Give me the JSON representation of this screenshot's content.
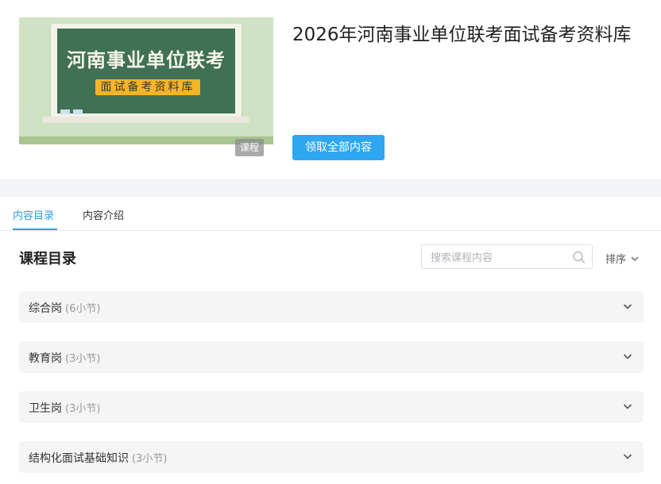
{
  "header": {
    "cover": {
      "board_title": "河南事业单位联考",
      "board_subtitle": "面试备考资料库",
      "tag": "课程"
    },
    "title": "2026年河南事业单位联考面试备考资料库",
    "claim_button": "领取全部内容"
  },
  "tabs": [
    {
      "label": "内容目录",
      "active": true
    },
    {
      "label": "内容介绍",
      "active": false
    }
  ],
  "catalog": {
    "title": "课程目录",
    "search": {
      "placeholder": "搜索课程内容",
      "value": ""
    },
    "sort_label": "排序",
    "sections": [
      {
        "name": "综合岗",
        "count": "(6小节)"
      },
      {
        "name": "教育岗",
        "count": "(3小节)"
      },
      {
        "name": "卫生岗",
        "count": "(3小节)"
      },
      {
        "name": "结构化面试基础知识",
        "count": "(3小节)"
      }
    ]
  },
  "colors": {
    "accent": "#2ea7f0",
    "board": "#3f7154",
    "board_label": "#f5b528"
  },
  "icons": {
    "search": "search-icon",
    "chevron": "chevron-down-icon"
  }
}
